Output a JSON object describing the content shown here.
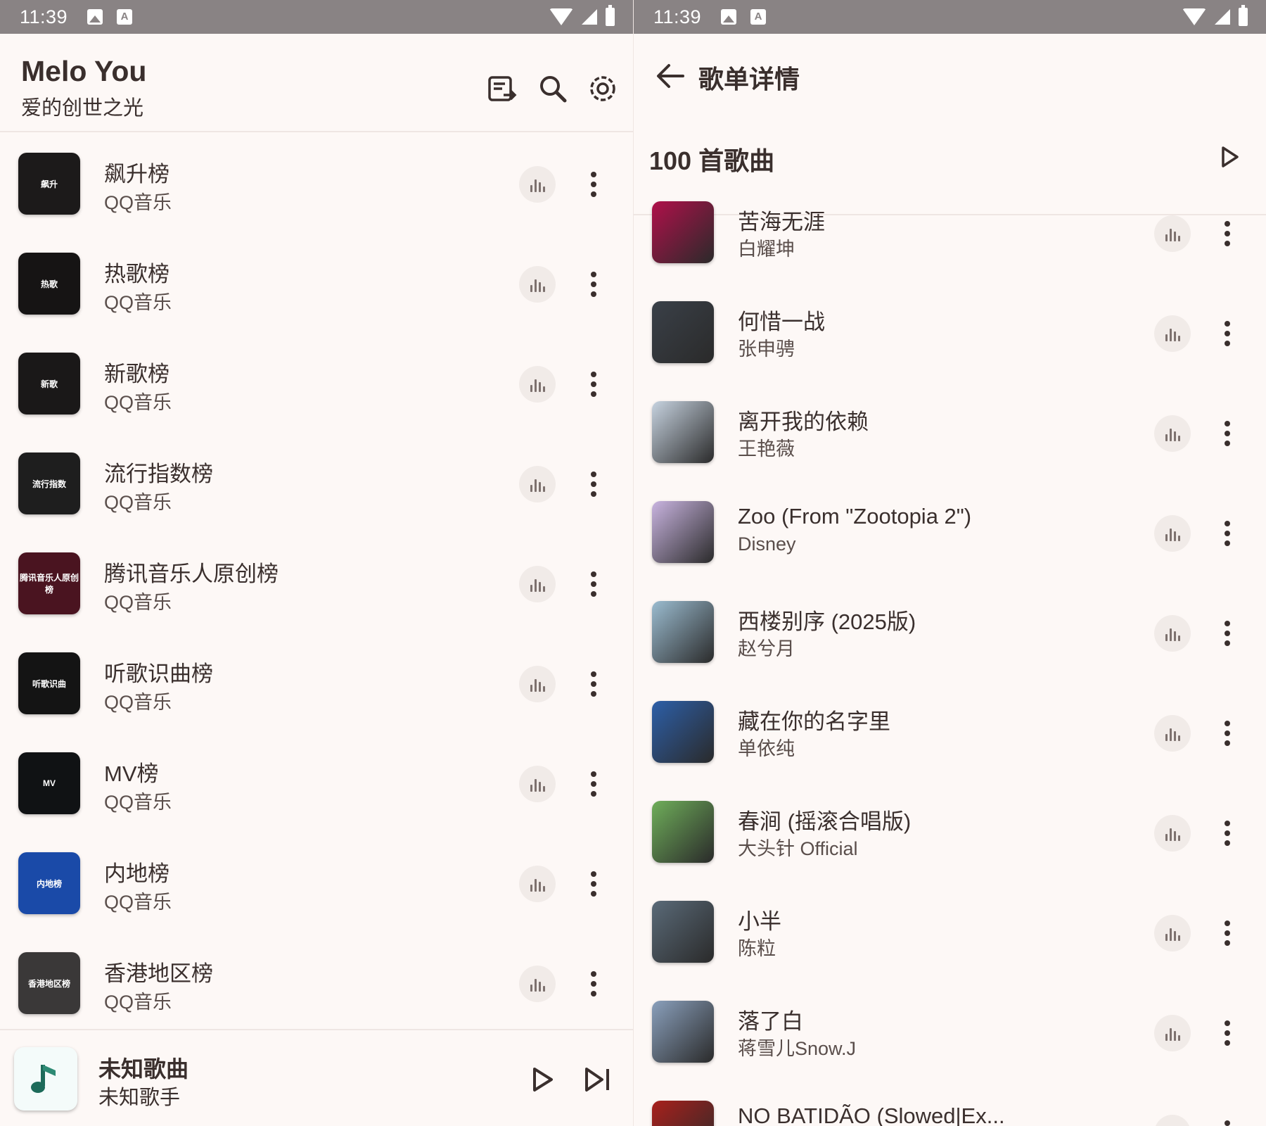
{
  "status": {
    "time": "11:39"
  },
  "left": {
    "app_title": "Melo You",
    "app_subtitle": "爱的创世之光",
    "header_icons": [
      "playlist-import-icon",
      "search-icon",
      "settings-icon"
    ],
    "charts": [
      {
        "title": "飙升榜",
        "source": "QQ音乐",
        "cover_text": "飙升",
        "cover_color": "#1c1a1a"
      },
      {
        "title": "热歌榜",
        "source": "QQ音乐",
        "cover_text": "热歌",
        "cover_color": "#161414"
      },
      {
        "title": "新歌榜",
        "source": "QQ音乐",
        "cover_text": "新歌",
        "cover_color": "#1a1818"
      },
      {
        "title": "流行指数榜",
        "source": "QQ音乐",
        "cover_text": "流行指数",
        "cover_color": "#1e1e1e"
      },
      {
        "title": "腾讯音乐人原创榜",
        "source": "QQ音乐",
        "cover_text": "腾讯音乐人原创榜",
        "cover_color": "#4a1420"
      },
      {
        "title": "听歌识曲榜",
        "source": "QQ音乐",
        "cover_text": "听歌识曲",
        "cover_color": "#141414"
      },
      {
        "title": "MV榜",
        "source": "QQ音乐",
        "cover_text": "MV",
        "cover_color": "#101214"
      },
      {
        "title": "内地榜",
        "source": "QQ音乐",
        "cover_text": "内地榜",
        "cover_color": "#1a4aa8"
      },
      {
        "title": "香港地区榜",
        "source": "QQ音乐",
        "cover_text": "香港地区榜",
        "cover_color": "#3a3838"
      }
    ],
    "mini_player": {
      "title": "未知歌曲",
      "artist": "未知歌手"
    }
  },
  "right": {
    "title": "歌单详情",
    "count_label": "100 首歌曲",
    "songs": [
      {
        "title": "苦海无涯",
        "artist": "白耀坤",
        "cover_color": "#b0104a"
      },
      {
        "title": "何惜一战",
        "artist": "张申骋",
        "cover_color": "#3a4048"
      },
      {
        "title": "离开我的依赖",
        "artist": "王艳薇",
        "cover_color": "#c7d3e0"
      },
      {
        "title": "Zoo (From \"Zootopia 2\")",
        "artist": "Disney",
        "cover_color": "#c9b4e0"
      },
      {
        "title": "西楼别序 (2025版)",
        "artist": "赵兮月",
        "cover_color": "#9bbcd0"
      },
      {
        "title": "藏在你的名字里",
        "artist": "单依纯",
        "cover_color": "#2d5fa8"
      },
      {
        "title": "春涧 (摇滚合唱版)",
        "artist": "大头针 Official",
        "cover_color": "#6fae5a"
      },
      {
        "title": "小半",
        "artist": "陈粒",
        "cover_color": "#5a6a78"
      },
      {
        "title": "落了白",
        "artist": "蒋雪儿Snow.J",
        "cover_color": "#8aa0bc"
      },
      {
        "title": "NO BATIDÃO (Slowed|Ex...",
        "artist": "",
        "cover_color": "#a8201c"
      }
    ]
  }
}
